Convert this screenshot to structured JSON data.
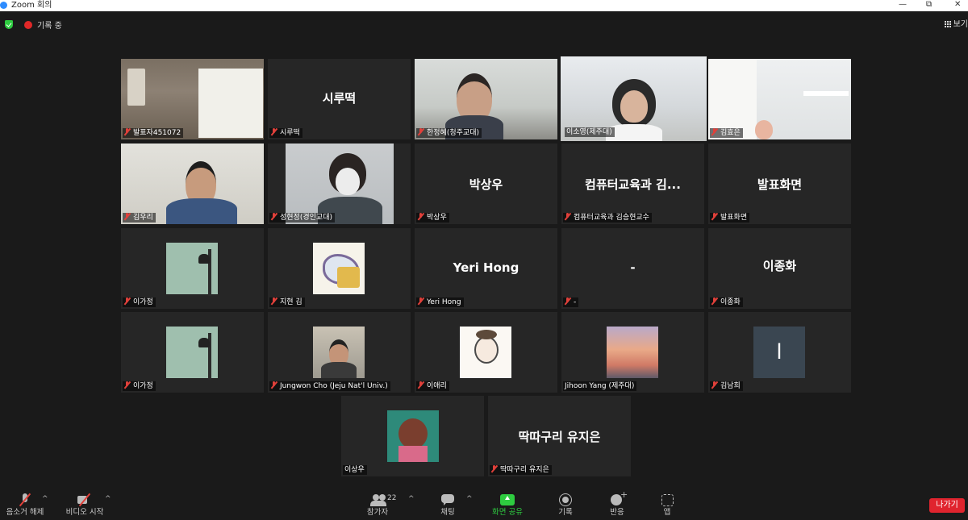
{
  "window": {
    "title": "Zoom 회의",
    "minimize": "—",
    "restore": "⧉",
    "close": "✕"
  },
  "topbar": {
    "recording_label": "기록 중",
    "view_label": "보기"
  },
  "tiles": [
    {
      "id": "t1",
      "name": "발표자451072",
      "big": ""
    },
    {
      "id": "t2",
      "name": "시루떡",
      "big": "시루떡"
    },
    {
      "id": "t3",
      "name": "한정혜(청주교대)",
      "big": ""
    },
    {
      "id": "t4",
      "name": "이소영(제주대)",
      "big": ""
    },
    {
      "id": "t5",
      "name": "김효은",
      "big": ""
    },
    {
      "id": "t6",
      "name": "김우리",
      "big": ""
    },
    {
      "id": "t7",
      "name": "성현정(경인교대)",
      "big": ""
    },
    {
      "id": "t8",
      "name": "박상우",
      "big": "박상우"
    },
    {
      "id": "t9",
      "name": "컴퓨터교육과 김승현교수",
      "big": "컴퓨터교육과 김..."
    },
    {
      "id": "t10",
      "name": "발표화면",
      "big": "발표화면"
    },
    {
      "id": "t11",
      "name": "이가정",
      "big": ""
    },
    {
      "id": "t12",
      "name": "지현 김",
      "big": ""
    },
    {
      "id": "t13",
      "name": "Yeri Hong",
      "big": "Yeri Hong"
    },
    {
      "id": "t14",
      "name": "-",
      "big": "-"
    },
    {
      "id": "t15",
      "name": "이종화",
      "big": "이종화"
    },
    {
      "id": "t16",
      "name": "이가정",
      "big": ""
    },
    {
      "id": "t17",
      "name": "Jungwon Cho (Jeju Nat'l Univ.)",
      "big": ""
    },
    {
      "id": "t18",
      "name": "이애리",
      "big": ""
    },
    {
      "id": "t19",
      "name": "Jihoon Yang (제주대)",
      "big": ""
    },
    {
      "id": "t20",
      "name": "김남희",
      "big": "",
      "avatar_letter": "l"
    },
    {
      "id": "t21",
      "name": "이상우",
      "big": ""
    },
    {
      "id": "t22",
      "name": "딱따구리 유지은",
      "big": "딱따구리 유지은"
    }
  ],
  "toolbar": {
    "mute": "음소거 해제",
    "video": "비디오 시작",
    "participants": "참가자",
    "participants_count": "22",
    "chat": "채팅",
    "share": "화면 공유",
    "record": "기록",
    "reactions": "반응",
    "apps": "앱",
    "leave": "나가기",
    "caret": "^"
  },
  "colors": {
    "active_speaker": "#cde361",
    "leave_button": "#e0242e",
    "share_green": "#2ecc40",
    "muted_red": "#e0403a"
  }
}
